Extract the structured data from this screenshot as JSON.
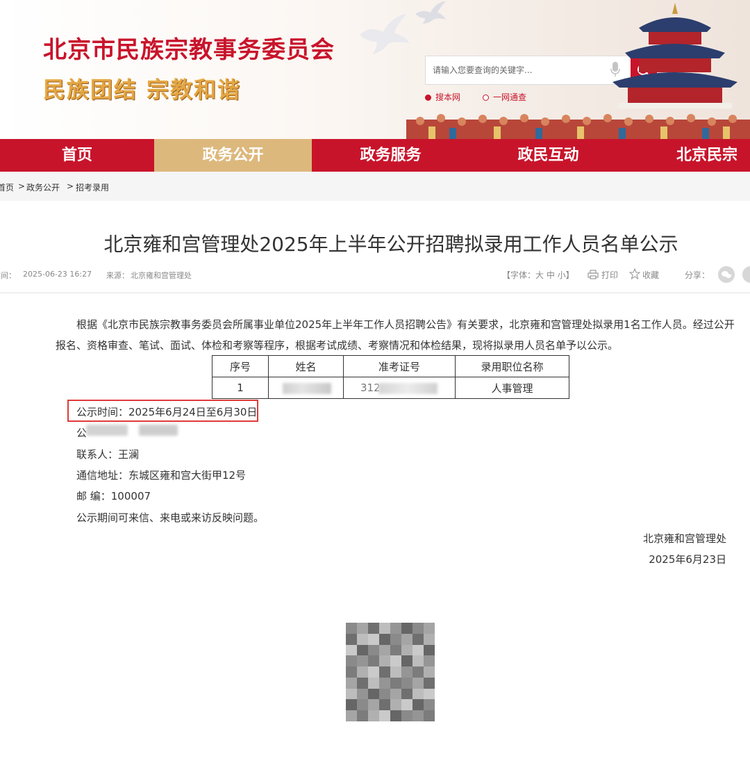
{
  "header": {
    "site_title": "北京市民族宗教事务委员会",
    "slogan": "民族团结  宗教和谐",
    "search": {
      "placeholder": "请输入您要查询的关键字..."
    },
    "scope_options": [
      {
        "label": "搜本网",
        "selected": true
      },
      {
        "label": "一网通查",
        "selected": false
      }
    ]
  },
  "nav": {
    "items": [
      "首页",
      "政务公开",
      "政务服务",
      "政民互动",
      "北京民宗"
    ],
    "active_index": 1
  },
  "breadcrumb": {
    "items": [
      "首页",
      "政务公开",
      "招考录用"
    ],
    "separator": ">"
  },
  "article": {
    "title": "北京雍和宫管理处2025年上半年公开招聘拟录用工作人员名单公示",
    "time_label": "时间：",
    "time_value": "2025-06-23 16:27",
    "source_label": "来源：",
    "source_value": "北京雍和宫管理处",
    "font_size_label": "【字体：大 中 小】",
    "print_label": "打印",
    "favorite_label": "收藏",
    "share_label": "分享：",
    "intro": "根据《北京市民族宗教事务委员会所属事业单位2025年上半年工作人员招聘公告》有关要求，北京雍和宫管理处拟录用1名工作人员。经过公开报名、资格审查、笔试、面试、体检和考察等程序，根据考试成绩、考察情况和体检结果，现将拟录用人员名单予以公示。",
    "table": {
      "headers": [
        "序号",
        "姓名",
        "准考证号",
        "录用职位名称"
      ],
      "rows": [
        {
          "index": "1",
          "name": "",
          "exam_no_prefix": "312",
          "position": "人事管理"
        }
      ]
    },
    "publicity_period": "公示时间：2025年6月24日至6月30日",
    "phone_prefix": "公",
    "contact": "联系人：王澜",
    "address": "通信地址：东城区雍和宫大街甲12号",
    "postcode": "邮 编：100007",
    "feedback": "公示期间可来信、来电或来访反映问题。",
    "signature_org": "北京雍和宫管理处",
    "signature_date": "2025年6月23日"
  },
  "colors": {
    "brand_red": "#c8142b",
    "nav_active": "#ddb87d",
    "highlight": "#e03a3a"
  },
  "icons": [
    "mic-icon",
    "search-icon",
    "print-icon",
    "star-icon",
    "wechat-icon",
    "weibo-icon"
  ]
}
